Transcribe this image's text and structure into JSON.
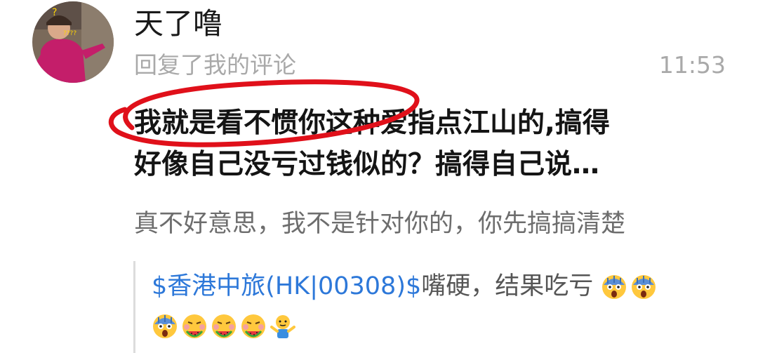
{
  "comment": {
    "user": {
      "name": "天了噜"
    },
    "action": "回复了我的评论",
    "time": "11:53",
    "reply_lines": [
      "我就是看不惯你这种爱指点江山的,搞得",
      "好像自己没亏过钱似的？搞得自己说…"
    ],
    "original_text": "真不好意思，我不是针对你的，你先搞搞清楚",
    "quote": {
      "stock_link": "$香港中旅(HK|00308)$",
      "text": "嘴硬，结果吃亏",
      "emojis": [
        "shocked-emoji",
        "shocked-emoji",
        "shocked-emoji",
        "eating-watermelon-emoji",
        "eating-watermelon-emoji",
        "eating-watermelon-emoji",
        "shrug-emoji"
      ]
    }
  },
  "colors": {
    "link": "#2d78d9",
    "annotation": "#e0101a",
    "secondary_text": "#a9a9a9"
  }
}
